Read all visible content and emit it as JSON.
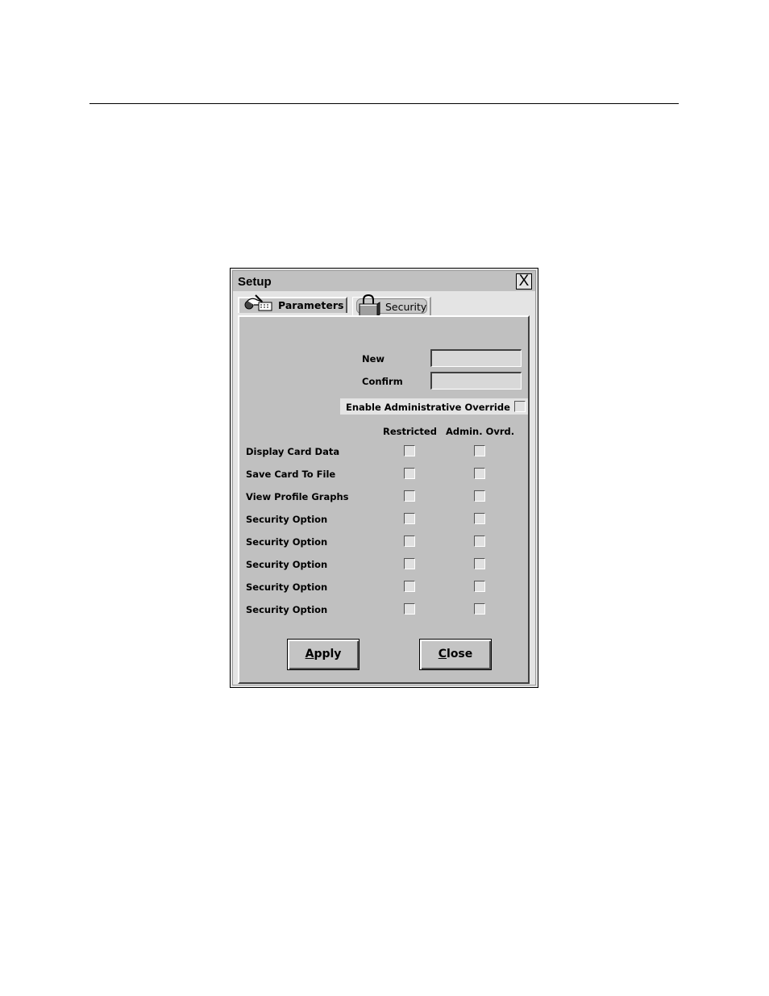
{
  "window": {
    "title": "Setup",
    "close_icon": "close-x-icon"
  },
  "tabs": [
    {
      "label": "Parameters",
      "icon": "hand-keypad-icon",
      "active": false
    },
    {
      "label": "Security",
      "icon": "padlock-icon",
      "active": true
    }
  ],
  "password": {
    "new_label": "New",
    "new_value": "",
    "confirm_label": "Confirm",
    "confirm_value": ""
  },
  "override": {
    "label": "Enable Administrative Override",
    "checked": false
  },
  "columns": {
    "restricted": "Restricted",
    "admin_override": "Admin. Ovrd."
  },
  "options": [
    {
      "label": "Display Card Data",
      "restricted": false,
      "admin_override": false
    },
    {
      "label": "Save Card To File",
      "restricted": false,
      "admin_override": false
    },
    {
      "label": "View Profile Graphs",
      "restricted": false,
      "admin_override": false
    },
    {
      "label": "Security Option",
      "restricted": false,
      "admin_override": false
    },
    {
      "label": "Security Option",
      "restricted": false,
      "admin_override": false
    },
    {
      "label": "Security Option",
      "restricted": false,
      "admin_override": false
    },
    {
      "label": "Security Option",
      "restricted": false,
      "admin_override": false
    },
    {
      "label": "Security Option",
      "restricted": false,
      "admin_override": false
    }
  ],
  "buttons": {
    "apply_mnemonic": "A",
    "apply_rest": "pply",
    "close_mnemonic": "C",
    "close_rest": "lose"
  }
}
